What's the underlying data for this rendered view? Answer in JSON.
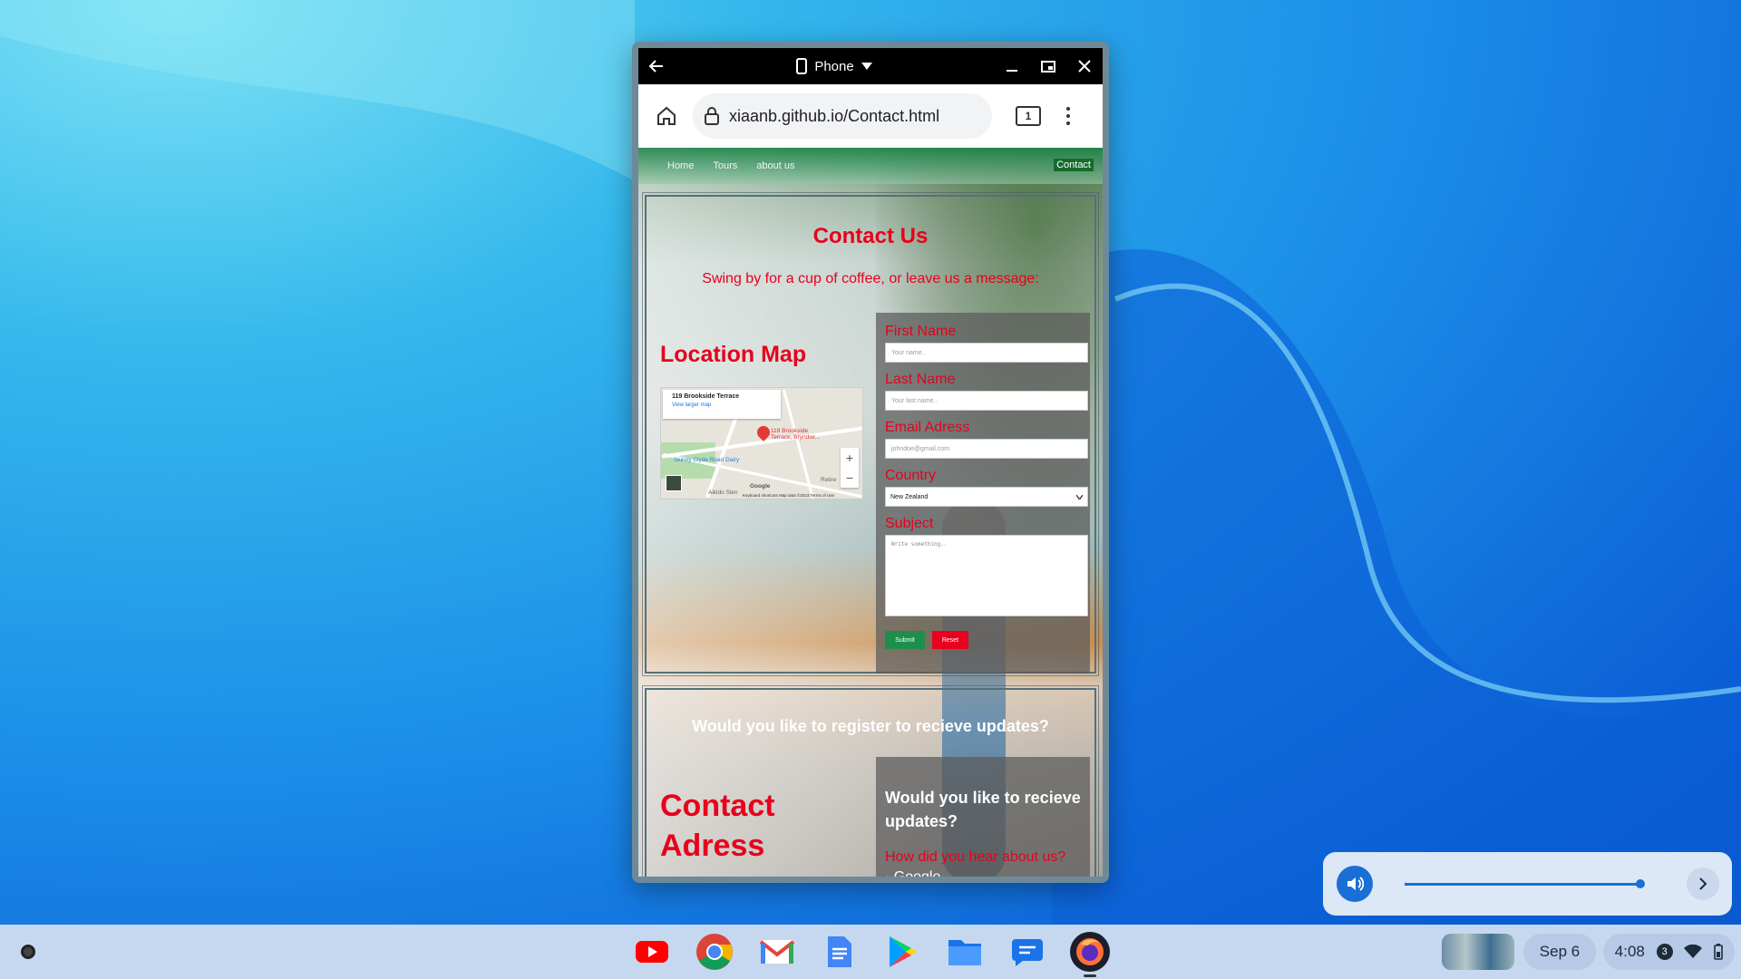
{
  "window": {
    "device_label": "Phone"
  },
  "browser": {
    "url": "xiaanb.github.io/Contact.html",
    "tab_count": "1"
  },
  "site": {
    "nav": {
      "home": "Home",
      "tours": "Tours",
      "about": "about us",
      "contact": "Contact"
    },
    "contact_heading": "Contact Us",
    "subtitle": "Swing by for a cup of coffee, or leave us a message:",
    "location_heading": "Location Map",
    "map": {
      "place_title": "119 Brookside Terrace",
      "larger_map": "View larger map",
      "pin_label_1": "119 Brookside",
      "pin_label_2": "Terrace, Bryndwr...",
      "poi": "Skinny Clyde Road Dairy",
      "poi2": "Aikido Slen",
      "retire": "Retire",
      "footer": "Keyboard shortcuts   Map data ©2023   Terms of Use",
      "google": "Google"
    },
    "form": {
      "first_name_label": "First Name",
      "first_name_placeholder": "Your name..",
      "last_name_label": "Last Name",
      "last_name_placeholder": "Your last name..",
      "email_label": "Email Adress",
      "email_placeholder": "johndoe@gmail.com",
      "country_label": "Country",
      "country_value": "New Zealand",
      "subject_label": "Subject",
      "subject_placeholder": "Write something..",
      "submit": "Submit",
      "reset": "Reset"
    },
    "register_heading": "Would you like to register to recieve updates?",
    "address_heading_1": "Contact",
    "address_heading_2": "Adress",
    "updates": {
      "title": "Would you like to recieve updates?",
      "question": "How did you hear about us?",
      "option_1": "Google"
    }
  },
  "volume": {
    "level_fraction": 1.0
  },
  "shelf": {
    "apps": [
      "youtube-icon",
      "chrome-icon",
      "gmail-icon",
      "docs-icon",
      "play-store-icon",
      "files-icon",
      "messages-icon",
      "firefox-icon"
    ],
    "date": "Sep 6",
    "time": "4:08",
    "notification_count": "3"
  },
  "colors": {
    "accent_red": "#e8001c",
    "nav_green": "#176b2b",
    "chromeos_blue": "#1a6fd6"
  }
}
